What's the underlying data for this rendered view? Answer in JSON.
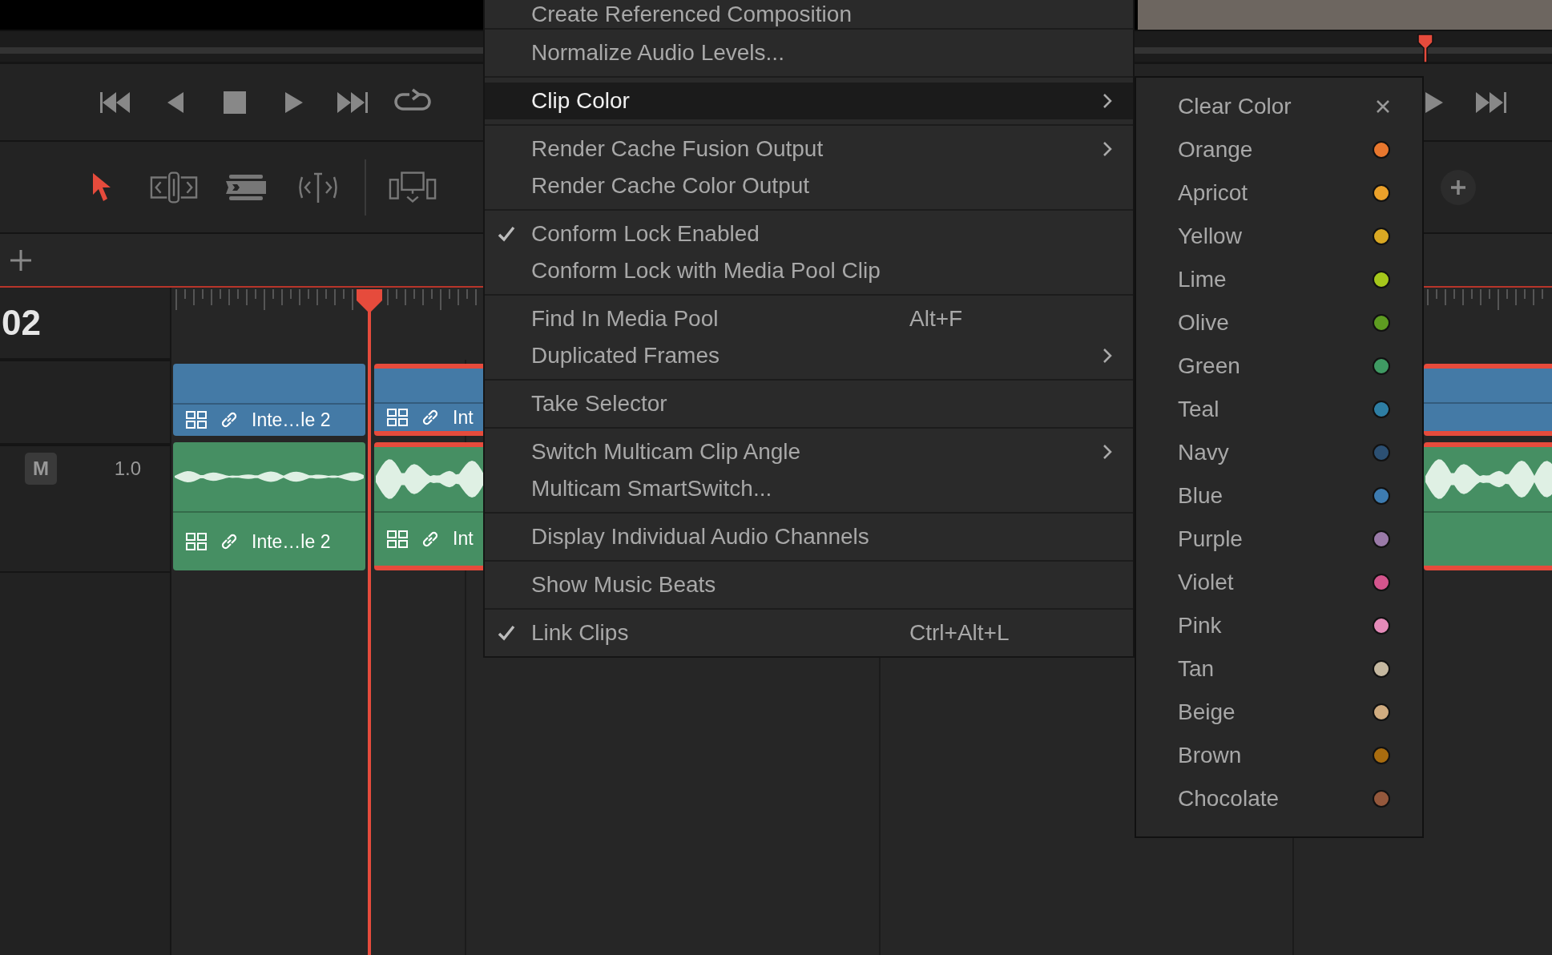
{
  "timeline": {
    "timecode": "02",
    "tracks": [
      {
        "kind": "video",
        "clips": [
          {
            "label": "Inte…le 2",
            "selected": false
          },
          {
            "label": "Int",
            "selected": true
          },
          {
            "selected": true
          }
        ]
      },
      {
        "kind": "audio",
        "mute_label": "M",
        "volume": "1.0",
        "clips": [
          {
            "label": "Inte…le 2",
            "selected": false
          },
          {
            "label": "Int",
            "selected": true
          },
          {
            "selected": true
          }
        ]
      }
    ]
  },
  "context_menu": {
    "groups": [
      {
        "items": [
          {
            "label": "Create Referenced Composition",
            "checked": false,
            "highlighted": false,
            "submenu": false
          }
        ]
      },
      {
        "items": [
          {
            "label": "Normalize Audio Levels...",
            "checked": false,
            "highlighted": false,
            "submenu": false
          }
        ]
      },
      {
        "items": [
          {
            "label": "Clip Color",
            "checked": false,
            "highlighted": true,
            "submenu": true
          }
        ]
      },
      {
        "items": [
          {
            "label": "Render Cache Fusion Output",
            "checked": false,
            "highlighted": false,
            "submenu": true
          },
          {
            "label": "Render Cache Color Output",
            "checked": false,
            "highlighted": false,
            "submenu": false
          }
        ]
      },
      {
        "items": [
          {
            "label": "Conform Lock Enabled",
            "checked": true,
            "highlighted": false,
            "submenu": false
          },
          {
            "label": "Conform Lock with Media Pool Clip",
            "checked": false,
            "highlighted": false,
            "submenu": false
          }
        ]
      },
      {
        "items": [
          {
            "label": "Find In Media Pool",
            "shortcut": "Alt+F",
            "checked": false,
            "highlighted": false,
            "submenu": false
          },
          {
            "label": "Duplicated Frames",
            "checked": false,
            "highlighted": false,
            "submenu": true
          }
        ]
      },
      {
        "items": [
          {
            "label": "Take Selector",
            "checked": false,
            "highlighted": false,
            "submenu": false
          }
        ]
      },
      {
        "items": [
          {
            "label": "Switch Multicam Clip Angle",
            "checked": false,
            "highlighted": false,
            "submenu": true
          },
          {
            "label": "Multicam SmartSwitch...",
            "checked": false,
            "highlighted": false,
            "submenu": false
          }
        ]
      },
      {
        "items": [
          {
            "label": "Display Individual Audio Channels",
            "checked": false,
            "highlighted": false,
            "submenu": false
          }
        ]
      },
      {
        "items": [
          {
            "label": "Show Music Beats",
            "checked": false,
            "highlighted": false,
            "submenu": false
          }
        ]
      },
      {
        "items": [
          {
            "label": "Link Clips",
            "shortcut": "Ctrl+Alt+L",
            "checked": true,
            "highlighted": false,
            "submenu": false
          }
        ]
      }
    ]
  },
  "clip_color_menu": {
    "items": [
      {
        "kind": "clear",
        "label": "Clear Color"
      },
      {
        "kind": "swatch",
        "label": "Orange",
        "color": "#e8772e"
      },
      {
        "kind": "swatch",
        "label": "Apricot",
        "color": "#eba12a"
      },
      {
        "kind": "swatch",
        "label": "Yellow",
        "color": "#d9a823"
      },
      {
        "kind": "swatch",
        "label": "Lime",
        "color": "#a5c71b"
      },
      {
        "kind": "swatch",
        "label": "Olive",
        "color": "#5e9c21"
      },
      {
        "kind": "swatch",
        "label": "Green",
        "color": "#3f9a63"
      },
      {
        "kind": "swatch",
        "label": "Teal",
        "color": "#2e7ea4"
      },
      {
        "kind": "swatch",
        "label": "Navy",
        "color": "#2c5073"
      },
      {
        "kind": "swatch",
        "label": "Blue",
        "color": "#3d7bb0"
      },
      {
        "kind": "swatch",
        "label": "Purple",
        "color": "#9a7aa8"
      },
      {
        "kind": "swatch",
        "label": "Violet",
        "color": "#d4558d"
      },
      {
        "kind": "swatch",
        "label": "Pink",
        "color": "#e58bb9"
      },
      {
        "kind": "swatch",
        "label": "Tan",
        "color": "#c5b8a0"
      },
      {
        "kind": "swatch",
        "label": "Beige",
        "color": "#d0ac80"
      },
      {
        "kind": "swatch",
        "label": "Brown",
        "color": "#a86c0f"
      },
      {
        "kind": "swatch",
        "label": "Chocolate",
        "color": "#94583c"
      }
    ]
  }
}
